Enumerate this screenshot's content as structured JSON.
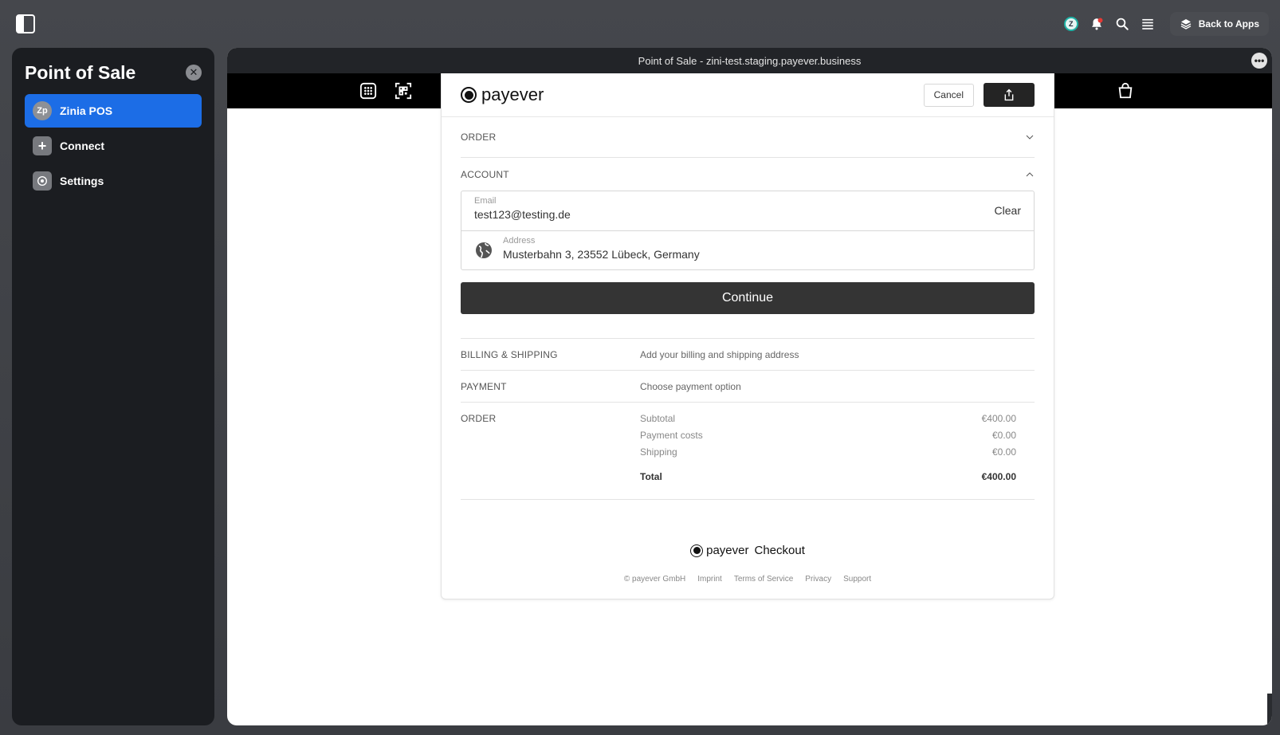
{
  "topbar": {
    "back_to_apps": "Back to Apps",
    "avatar_initial": "Z"
  },
  "sidebar": {
    "title": "Point of Sale",
    "items": [
      {
        "label": "Zinia POS",
        "badge": "Zp",
        "active": true
      },
      {
        "label": "Connect"
      },
      {
        "label": "Settings"
      }
    ]
  },
  "window": {
    "title": "Point of Sale - zini-test.staging.payever.business"
  },
  "checkout": {
    "brand": "payever",
    "cancel_label": "Cancel",
    "order_section": "ORDER",
    "account_section": "ACCOUNT",
    "email": {
      "label": "Email",
      "value": "test123@testing.de",
      "clear_label": "Clear"
    },
    "address": {
      "label": "Address",
      "value": "Musterbahn 3, 23552 Lübeck, Germany"
    },
    "continue_label": "Continue",
    "summary": {
      "billing_label": "BILLING & SHIPPING",
      "billing_text": "Add your billing and shipping address",
      "payment_label": "PAYMENT",
      "payment_text": "Choose payment option",
      "order_label": "ORDER",
      "lines": [
        {
          "label": "Subtotal",
          "value": "€400.00"
        },
        {
          "label": "Payment costs",
          "value": "€0.00"
        },
        {
          "label": "Shipping",
          "value": "€0.00"
        }
      ],
      "total_label": "Total",
      "total_value": "€400.00"
    },
    "footer": {
      "brand": "payever",
      "checkout": "Checkout",
      "links": [
        "© payever GmbH",
        "Imprint",
        "Terms of Service",
        "Privacy",
        "Support"
      ]
    }
  },
  "colors": {
    "accent": "#1c6de6",
    "notification": "#e53935"
  }
}
